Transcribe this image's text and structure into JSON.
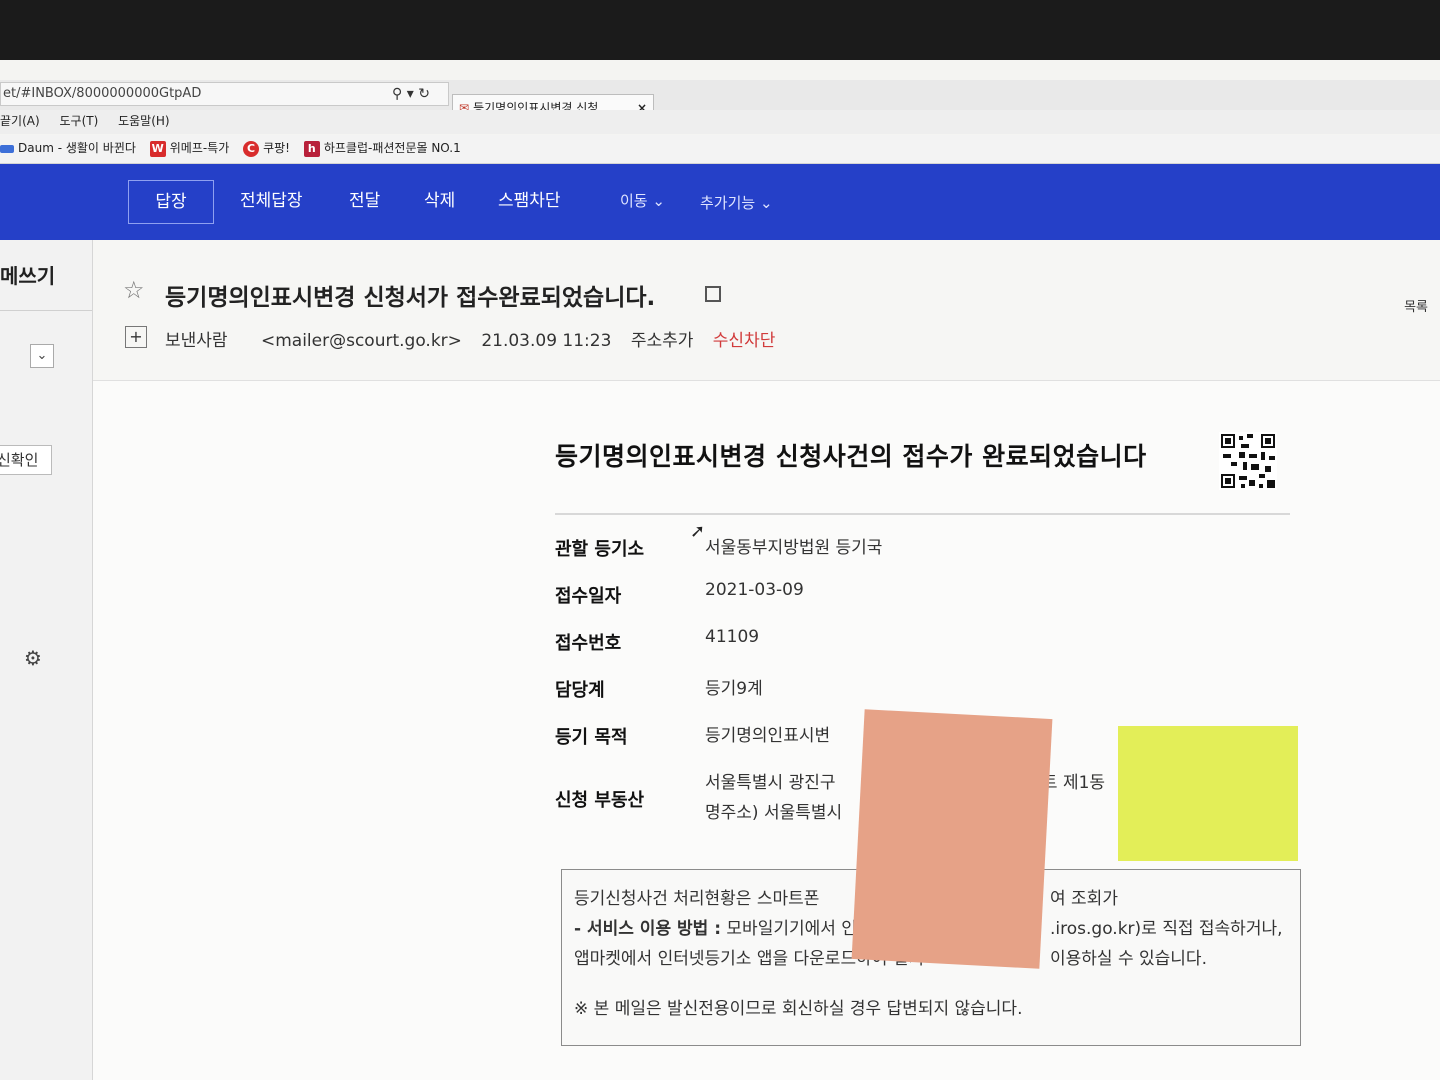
{
  "browser": {
    "address": "et/#INBOX/8000000000GtpAD",
    "tab_title": "등기명의인표시변경 신청...",
    "menu": [
      "끝기(A)",
      "도구(T)",
      "도움말(H)"
    ],
    "favorites": [
      {
        "label": "Daum - 생활이 바뀐다"
      },
      {
        "label": "위메프-특가",
        "icon": "W"
      },
      {
        "label": "쿠팡!",
        "icon": "C"
      },
      {
        "label": "하프클럽-패션전문몰 NO.1",
        "icon": "h"
      }
    ]
  },
  "toolbar": {
    "reply": "답장",
    "reply_all": "전체답장",
    "forward": "전달",
    "delete": "삭제",
    "spam_block": "스팸차단",
    "move": "이동 ⌄",
    "more": "추가기능 ⌄"
  },
  "leftpane": {
    "write": "메쓰기",
    "confirm": "신확인"
  },
  "message": {
    "subject": "등기명의인표시변경 신청서가 접수완료되었습니다.",
    "list_link": "목록",
    "sender_label": "보낸사람",
    "sender_email": "<mailer@scourt.go.kr>",
    "date": "21.03.09 11:23",
    "add_address": "주소추가",
    "block_receive": "수신차단"
  },
  "document": {
    "title": "등기명의인표시변경 신청사건의 접수가 완료되었습니다",
    "rows": [
      {
        "label": "관할 등기소",
        "value": "서울동부지방법원 등기국"
      },
      {
        "label": "접수일자",
        "value": "2021-03-09"
      },
      {
        "label": "접수번호",
        "value": "41109"
      },
      {
        "label": "담당계",
        "value": "등기9계"
      },
      {
        "label": "등기 목적",
        "value": "등기명의인표시변"
      },
      {
        "label": "신청 부동산",
        "value": "서울특별시 광진구",
        "value2": "명주소) 서울특별시"
      }
    ],
    "notice": {
      "line1": "등기신청사건 처리현황은 스마트폰",
      "line1b": "여 조회가",
      "line2_bold": "- 서비스 이용 방법 :",
      "line2": "모바일기기에서 인터",
      "line2b": ".iros.go.kr)로 직접 접속하거나,",
      "line3": "앱마켓에서 인터넷등기소 앱을 다운로드하여 설치",
      "line3b": "이용하실 수 있습니다.",
      "line4": "※ 본 메일은 발신전용이므로 회신하실 경우 답변되지 않습니다."
    },
    "partial_addr": "장아파트 제1동"
  }
}
